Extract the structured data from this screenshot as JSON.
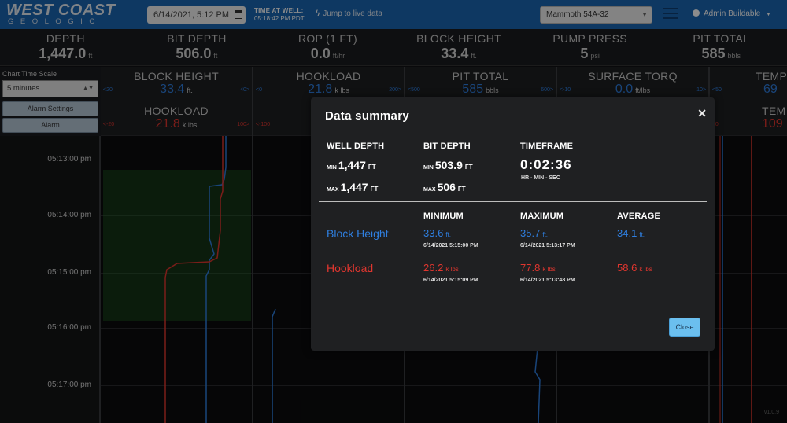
{
  "topbar": {
    "logo_line1": "WEST COAST",
    "logo_line2": "GEOLOGIC",
    "date_value": "6/14/2021, 5:12 PM",
    "time_at_well_label": "TIME AT WELL:",
    "time_at_well_value": "05:18:42 PM PDT",
    "jump_label": "Jump to live data",
    "well_selected": "Mammoth 54A-32",
    "user_label": "Admin Buildable"
  },
  "metrics": [
    {
      "label": "DEPTH",
      "value": "1,447.0",
      "unit": "ft"
    },
    {
      "label": "BIT DEPTH",
      "value": "506.0",
      "unit": "ft"
    },
    {
      "label": "ROP (1 FT)",
      "value": "0.0",
      "unit": "ft/hr"
    },
    {
      "label": "BLOCK HEIGHT",
      "value": "33.4",
      "unit": "ft."
    },
    {
      "label": "PUMP PRESS",
      "value": "5",
      "unit": "psi"
    },
    {
      "label": "PIT TOTAL",
      "value": "585",
      "unit": "bbls"
    }
  ],
  "left_panel": {
    "title": "Chart Time Scale",
    "scale_value": "5 minutes",
    "alarm_settings_label": "Alarm Settings",
    "alarm_label": "Alarm"
  },
  "tracks": [
    {
      "label": "BLOCK HEIGHT",
      "value": "33.4",
      "unit": "ft.",
      "min": "<20",
      "max": "40>",
      "label2": "HOOKLOAD",
      "value2": "21.8",
      "unit2": "k lbs",
      "min2": "<-20",
      "max2": "100>"
    },
    {
      "label": "HOOKLOAD",
      "value": "21.8",
      "unit": "k lbs",
      "min": "<0",
      "max": "200>",
      "label2": "",
      "value2": "",
      "unit2": "",
      "min2": "<-100",
      "max2": ""
    },
    {
      "label": "PIT TOTAL",
      "value": "585",
      "unit": "bbls",
      "min": "<500",
      "max": "600>",
      "label2": "",
      "value2": "",
      "unit2": "",
      "min2": "",
      "max2": ""
    },
    {
      "label": "SURFACE TORQ",
      "value": "0.0",
      "unit": "ft/lbs",
      "min": "<-10",
      "max": "10>",
      "label2": "",
      "value2": "",
      "unit2": "",
      "min2": "",
      "max2": ""
    },
    {
      "label": "TEMP",
      "value": "69",
      "unit": "",
      "min": "<50",
      "max": "",
      "label2": "TEM",
      "value2": "109",
      "unit2": "",
      "min2": "50",
      "max2": ""
    }
  ],
  "time_ticks": [
    "05:13:00 pm",
    "05:14:00 pm",
    "05:15:00 pm",
    "05:16:00 pm",
    "05:17:00 pm"
  ],
  "version": "v1.0.9",
  "modal": {
    "title": "Data summary",
    "well_depth_label": "WELL DEPTH",
    "bit_depth_label": "BIT DEPTH",
    "timeframe_label": "TIMEFRAME",
    "min_label": "MIN",
    "max_label": "MAX",
    "well_depth_min": "1,447",
    "well_depth_max": "1,447",
    "bit_depth_min": "503.9",
    "bit_depth_max": "506",
    "depth_unit": "FT",
    "timeframe_value": "0:02:36",
    "timeframe_sub": "HR - MIN - SEC",
    "col_minimum": "MINIMUM",
    "col_maximum": "MAXIMUM",
    "col_average": "AVERAGE",
    "rows": [
      {
        "label": "Block Height",
        "min": "33.6",
        "min_unit": "ft.",
        "min_time": "6/14/2021 5:15:00 PM",
        "max": "35.7",
        "max_unit": "ft.",
        "max_time": "6/14/2021 5:13:17 PM",
        "avg": "34.1",
        "avg_unit": "ft."
      },
      {
        "label": "Hookload",
        "min": "26.2",
        "min_unit": "k lbs",
        "min_time": "6/14/2021 5:15:09 PM",
        "max": "77.8",
        "max_unit": "k lbs",
        "max_time": "6/14/2021 5:13:48 PM",
        "avg": "58.6",
        "avg_unit": "k lbs"
      }
    ],
    "close_label": "Close"
  },
  "colors": {
    "topbar": "#1b66b3",
    "blue_series": "#2f7fe0",
    "red_series": "#e0362f",
    "close_button": "#6bbfef"
  }
}
